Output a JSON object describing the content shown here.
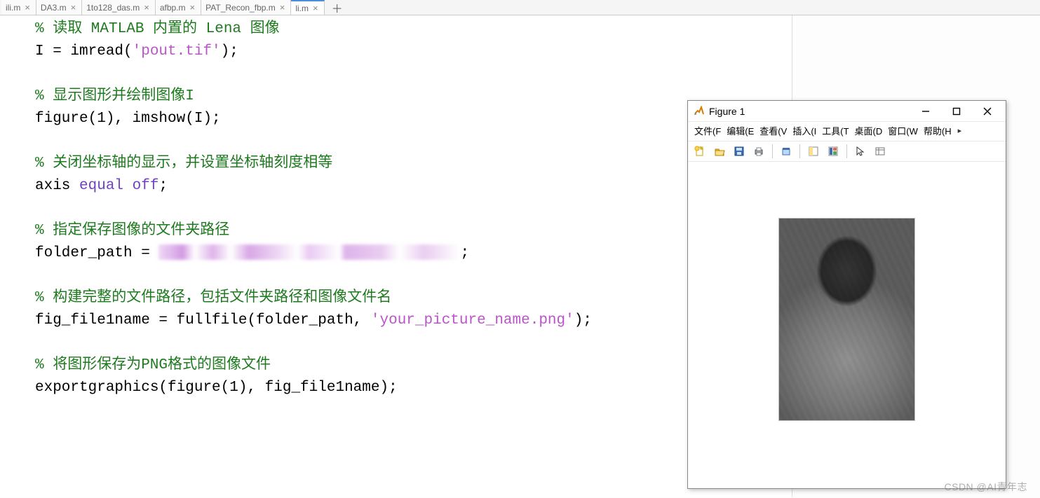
{
  "tabs": [
    {
      "label": "ili.m"
    },
    {
      "label": "DA3.m"
    },
    {
      "label": "1to128_das.m"
    },
    {
      "label": "afbp.m"
    },
    {
      "label": "PAT_Recon_fbp.m"
    },
    {
      "label": "li.m"
    }
  ],
  "code": {
    "c1a": "% 读取 MATLAB 内置的 Lena 图像",
    "l2": "I = imread(",
    "l2s": "'pout.tif'",
    "l2e": ");",
    "c3": "% 显示图形并绘制图像I",
    "l4a": "figure(1), imshow(I);",
    "c5": "% 关闭坐标轴的显示，并设置坐标轴刻度相等",
    "l6a": "axis ",
    "l6b": "equal off",
    "l6c": ";",
    "c7": "% 指定保存图像的文件夹路径",
    "l8": "folder_path = ",
    "c9": "% 构建完整的文件路径，包括文件夹路径和图像文件名",
    "l10": "fig_file1name = fullfile(folder_path, ",
    "l10s": "'your_picture_name.png'",
    "l10e": ");",
    "c11": "% 将图形保存为PNG格式的图像文件",
    "l12": "exportgraphics(figure(1), fig_file1name);"
  },
  "figure": {
    "title": "Figure 1",
    "menus": [
      "文件(F",
      "编辑(E",
      "查看(V",
      "插入(I",
      "工具(T",
      "桌面(D",
      "窗口(W",
      "帮助(H"
    ],
    "toolbar_icons": [
      "new-file-icon",
      "open-folder-icon",
      "save-icon",
      "print-icon",
      "copy-figure-icon",
      "data-cursor-icon",
      "colorbar-icon",
      "pointer-icon",
      "inspect-icon"
    ]
  },
  "watermark": "CSDN @AI青年志"
}
